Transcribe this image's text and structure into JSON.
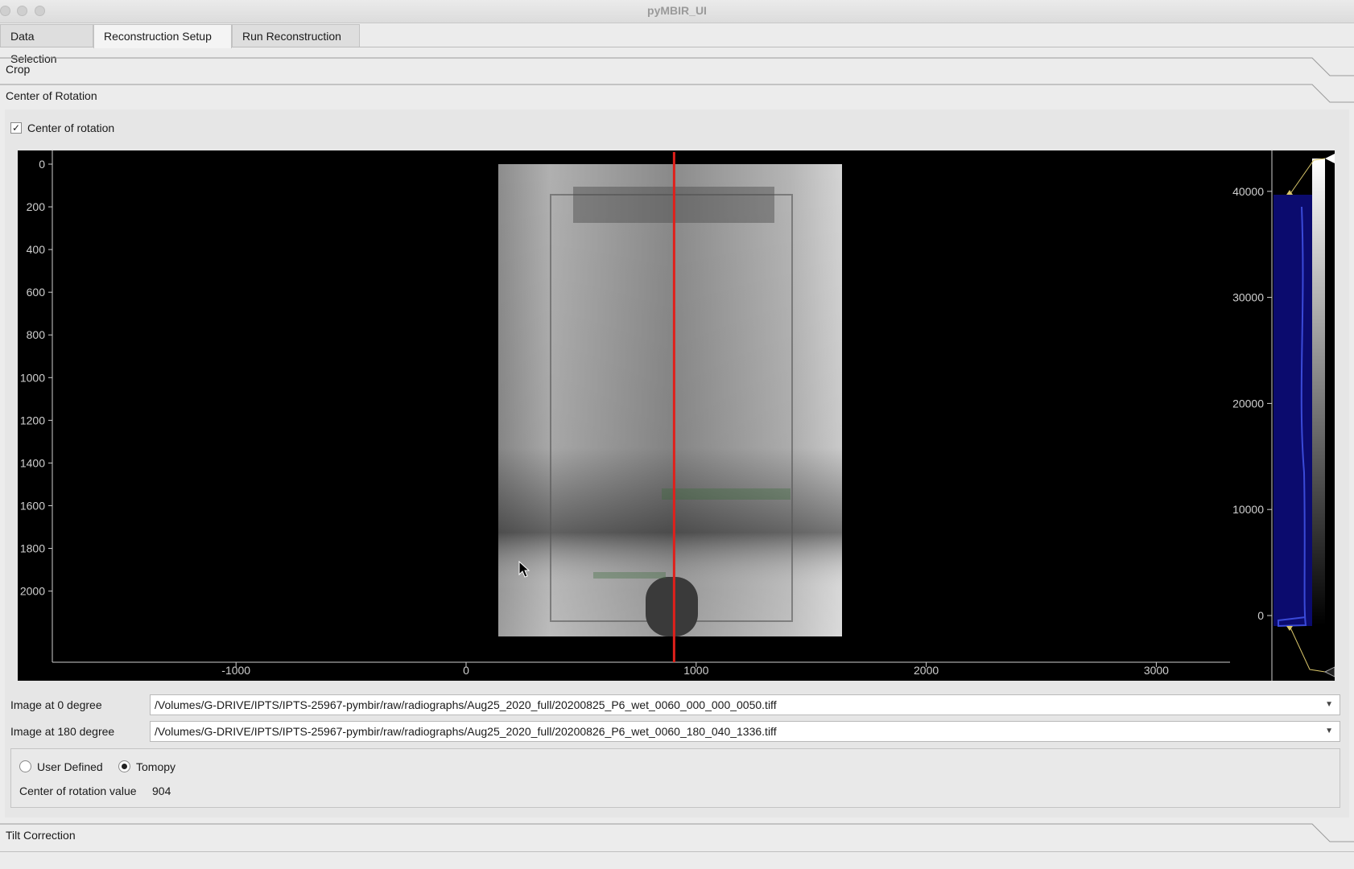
{
  "window": {
    "title": "pyMBIR_UI"
  },
  "tabs": [
    "Data Selection",
    "Reconstruction Setup",
    "Run Reconstruction"
  ],
  "sections": {
    "crop": "Crop",
    "center": "Center of Rotation",
    "tilt": "Tilt Correction"
  },
  "center_panel": {
    "checkbox_label": "Center of rotation",
    "checkbox_checked": true,
    "image0_label": "Image at 0 degree",
    "image0_value": "/Volumes/G-DRIVE/IPTS/IPTS-25967-pymbir/raw/radiographs/Aug25_2020_full/20200825_P6_wet_0060_000_000_0050.tiff",
    "image180_label": "Image at 180 degree",
    "image180_value": "/Volumes/G-DRIVE/IPTS/IPTS-25967-pymbir/raw/radiographs/Aug25_2020_full/20200826_P6_wet_0060_180_040_1336.tiff",
    "mode_user": "User Defined",
    "mode_tomopy": "Tomopy",
    "selected_mode": "Tomopy",
    "cor_label": "Center of rotation value",
    "cor_value": "904"
  },
  "image_plot": {
    "x_ticks": [
      "-1000",
      "0",
      "1000",
      "2000",
      "3000"
    ],
    "y_ticks": [
      "0",
      "200",
      "400",
      "600",
      "800",
      "1000",
      "1200",
      "1400",
      "1600",
      "1800",
      "2000"
    ],
    "center_line_x": 904,
    "line_color": "#e0201b"
  },
  "histogram": {
    "ticks": [
      "40000",
      "30000",
      "20000",
      "10000",
      "0"
    ],
    "fill_color": "#0b0b6e"
  }
}
